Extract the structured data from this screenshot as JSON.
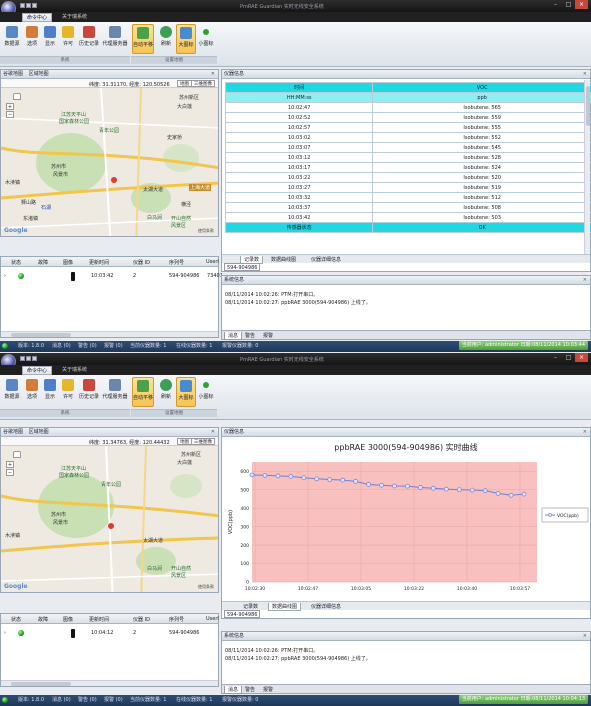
{
  "app": {
    "title": "PmRAE Guardian    实时无线安全系统",
    "tabs": [
      "命令中心",
      "关于瑞系统"
    ],
    "window_controls": [
      "–",
      "□",
      "×"
    ]
  },
  "ribbon": {
    "buttons": [
      {
        "label": "数据源",
        "icon": "database-icon"
      },
      {
        "label": "选项",
        "icon": "options-icon"
      },
      {
        "label": "显示",
        "icon": "display-icon"
      },
      {
        "label": "许可",
        "icon": "key-icon"
      },
      {
        "label": "历史记录",
        "icon": "history-icon"
      },
      {
        "label": "代理服务器",
        "icon": "proxy-server-icon"
      },
      {
        "label": "自动平移",
        "icon": "auto-pan-icon"
      },
      {
        "label": "刷新",
        "icon": "refresh-icon"
      },
      {
        "label": "大图标",
        "icon": "large-icon-icon"
      },
      {
        "label": "小图标",
        "icon": "small-icon-icon"
      }
    ],
    "groups": [
      "系统",
      "设置地图"
    ]
  },
  "screen1": {
    "map_panel": {
      "tabs": [
        "谷歌地图",
        "区域地图"
      ],
      "coordinates": "纬度: 31.31170, 经度: 120.50526",
      "map_btn": "地图",
      "sat_btn": "三维图像",
      "labels": [
        "江苏天平山",
        "国家森林公园",
        "青年公园",
        "苏州市",
        "风景市",
        "史家桥",
        "大白莲",
        "太湖大道",
        "白马涧",
        "开山自然",
        "风景区",
        "上海大道",
        "苏州新区",
        "狮山路",
        "石湖",
        "木渎镇",
        "东渚镇",
        "横泾"
      ],
      "copyright": "使用条款",
      "logo": "Google"
    },
    "device_grid": {
      "headers": [
        "状态",
        "故障",
        "图像",
        "更新时间",
        "仪器 ID",
        "序列号",
        "Userl"
      ],
      "rows": [
        {
          "time": "10:03:42",
          "id": "2",
          "serial": "594-904986",
          "user": "73401"
        }
      ]
    },
    "data_panel": {
      "title": "仪器信息",
      "header": [
        "时间",
        "VOC"
      ],
      "subheader": [
        "HH:MM:ss",
        "ppb"
      ],
      "rows": [
        [
          "10:02:47",
          "Isobutene: 565"
        ],
        [
          "10:02:52",
          "Isobutene: 559"
        ],
        [
          "10:02:57",
          "Isobutene: 555"
        ],
        [
          "10:03:02",
          "Isobutene: 552"
        ],
        [
          "10:03:07",
          "Isobutene: 545"
        ],
        [
          "10:03:12",
          "Isobutene: 528"
        ],
        [
          "10:03:17",
          "Isobutene: 524"
        ],
        [
          "10:03:22",
          "Isobutene: 520"
        ],
        [
          "10:03:27",
          "Isobutene: 519"
        ],
        [
          "10:03:32",
          "Isobutene: 512"
        ],
        [
          "10:03:37",
          "Isobutene: 508"
        ],
        [
          "10:03:42",
          "Isobutene: 503"
        ]
      ],
      "footer": [
        "传感器状态",
        "OK"
      ],
      "tabs": [
        "记录数",
        "数据曲线图",
        "仪器详细信息"
      ],
      "device_tag": "594-904986"
    },
    "log_panel": {
      "title": "系统信息",
      "lines": [
        "08/11/2014 10:02:26: PTM:打开串口。",
        "08/11/2014 10:02:27: ppbRAE 3000(594-904986) 上线了。"
      ],
      "tabs": [
        "消息",
        "警告",
        "报警"
      ]
    },
    "status": {
      "items": [
        "版本: 1.8.0",
        "消息 (0)",
        "警告 (0)",
        "报警 (0)",
        "当前仪器数量: 1",
        "在线仪器数量: 1",
        "报警仪器数量: 0"
      ],
      "user": "当前用户: administrator 日期:08/11/2014 10:03:44"
    }
  },
  "screen2": {
    "map_panel": {
      "tabs": [
        "谷歌地图",
        "区域地图"
      ],
      "coordinates": "纬度: 31.34763, 经度: 120.44432",
      "map_btn": "地图",
      "sat_btn": "三维图像",
      "labels": [
        "江苏天平山",
        "国家森林公园",
        "青年公园",
        "苏州市",
        "风景市",
        "大白莲",
        "太湖大道",
        "白马涧",
        "开山自然",
        "风景区",
        "苏州新区",
        "木渎镇"
      ],
      "copyright": "使用条款",
      "logo": "Google"
    },
    "device_grid": {
      "headers": [
        "状态",
        "故障",
        "图像",
        "更新时间",
        "仪器 ID",
        "序列号",
        "Userl"
      ],
      "rows": [
        {
          "time": "10:04:12",
          "id": "2",
          "serial": "594-904986",
          "user": ""
        }
      ]
    },
    "chart_panel": {
      "title": "仪器信息",
      "tabs": [
        "记录数",
        "数据曲线图",
        "仪器详细信息"
      ],
      "device_tag": "594-904986"
    },
    "log_panel": {
      "title": "系统信息",
      "lines": [
        "08/11/2014 10:02:26: PTM:打开串口。",
        "08/11/2014 10:02:27: ppbRAE 3000(594-904986) 上线了。"
      ],
      "tabs": [
        "消息",
        "警告",
        "报警"
      ]
    },
    "status": {
      "items": [
        "版本: 1.8.0",
        "消息 (0)",
        "警告 (0)",
        "报警 (0)",
        "当前仪器数量: 1",
        "在线仪器数量: 1",
        "报警仪器数量: 0"
      ],
      "user": "当前用户: administrator 日期:08/11/2014 10:04:13"
    }
  },
  "chart_data": {
    "type": "line",
    "title": "ppbRAE 3000(594-904986) 实时曲线",
    "xlabel": "",
    "ylabel": "VOC(ppb)",
    "ylim": [
      0,
      650
    ],
    "yticks": [
      0,
      100,
      200,
      300,
      400,
      500,
      600
    ],
    "xticks": [
      "10:02:30",
      "10:02:47",
      "10:03:05",
      "10:03:22",
      "10:03:40",
      "10:03:57"
    ],
    "xrange_seconds": [
      0,
      110
    ],
    "x": [
      0,
      5,
      10,
      15,
      20,
      25,
      30,
      35,
      40,
      45,
      50,
      55,
      60,
      65,
      70,
      75,
      80,
      85,
      90,
      95,
      100,
      105
    ],
    "series": [
      {
        "name": "VOC(ppb)",
        "color": "#6f7fd6",
        "values": [
          580,
          578,
          575,
          572,
          565,
          559,
          555,
          552,
          545,
          528,
          524,
          520,
          519,
          512,
          508,
          503,
          500,
          498,
          495,
          480,
          470,
          476
        ]
      }
    ],
    "plot_background": "#f9c0c0",
    "legend_position": "right"
  }
}
